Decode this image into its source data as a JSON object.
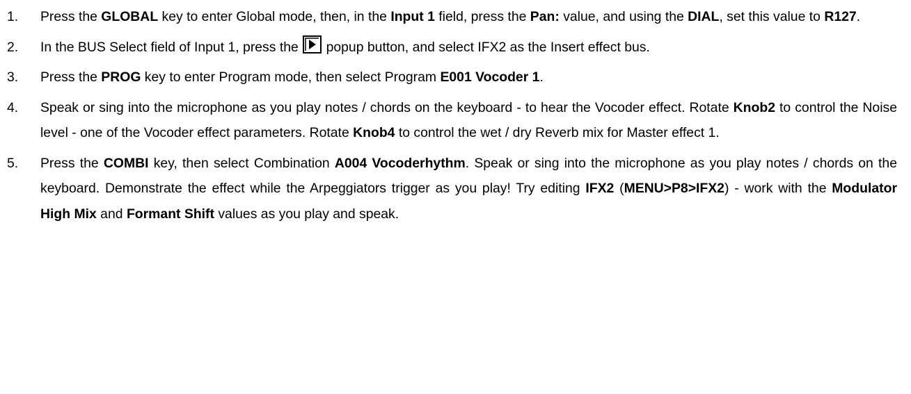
{
  "steps": [
    {
      "num": "1.",
      "parts": [
        {
          "t": "Press the "
        },
        {
          "t": "GLOBAL",
          "b": true
        },
        {
          "t": " key to enter Global mode, then, in the "
        },
        {
          "t": "Input 1",
          "b": true
        },
        {
          "t": " field, press the "
        },
        {
          "t": "Pan:",
          "b": true
        },
        {
          "t": " value, and using the "
        },
        {
          "t": "DIAL",
          "b": true
        },
        {
          "t": ", set this value to "
        },
        {
          "t": "R127",
          "b": true
        },
        {
          "t": "."
        }
      ]
    },
    {
      "num": "2.",
      "parts": [
        {
          "t": "In the BUS Select field of Input 1, press the "
        },
        {
          "icon": "popup-button-icon"
        },
        {
          "t": " popup button, and select IFX2 as the Insert effect bus."
        }
      ]
    },
    {
      "num": "3.",
      "parts": [
        {
          "t": "Press the "
        },
        {
          "t": "PROG",
          "b": true
        },
        {
          "t": " key to enter Program mode, then select Program "
        },
        {
          "t": "E001 Vocoder 1",
          "b": true
        },
        {
          "t": "."
        }
      ]
    },
    {
      "num": "4.",
      "parts": [
        {
          "t": "Speak or sing into the microphone as you play notes / chords on the keyboard - to hear the Vocoder effect. Rotate "
        },
        {
          "t": "Knob2",
          "b": true
        },
        {
          "t": " to control the Noise level - one of the Vocoder effect parameters. Rotate "
        },
        {
          "t": "Knob4",
          "b": true
        },
        {
          "t": " to control the wet / dry Reverb mix for Master effect 1."
        }
      ]
    },
    {
      "num": "5.",
      "parts": [
        {
          "t": "Press the "
        },
        {
          "t": "COMBI",
          "b": true
        },
        {
          "t": " key, then select Combination "
        },
        {
          "t": "A004 Vocoderhythm",
          "b": true
        },
        {
          "t": ". Speak or sing into the microphone as you play notes / chords on the keyboard. Demonstrate the effect while the Arpeggiators trigger as you play! Try editing "
        },
        {
          "t": "IFX2",
          "b": true
        },
        {
          "t": " ("
        },
        {
          "t": "MENU>P8>IFX2",
          "b": true
        },
        {
          "t": ") - work with the "
        },
        {
          "t": "Modulator High Mix",
          "b": true
        },
        {
          "t": " and "
        },
        {
          "t": "Formant Shift",
          "b": true
        },
        {
          "t": " values as you play and speak."
        }
      ]
    }
  ]
}
